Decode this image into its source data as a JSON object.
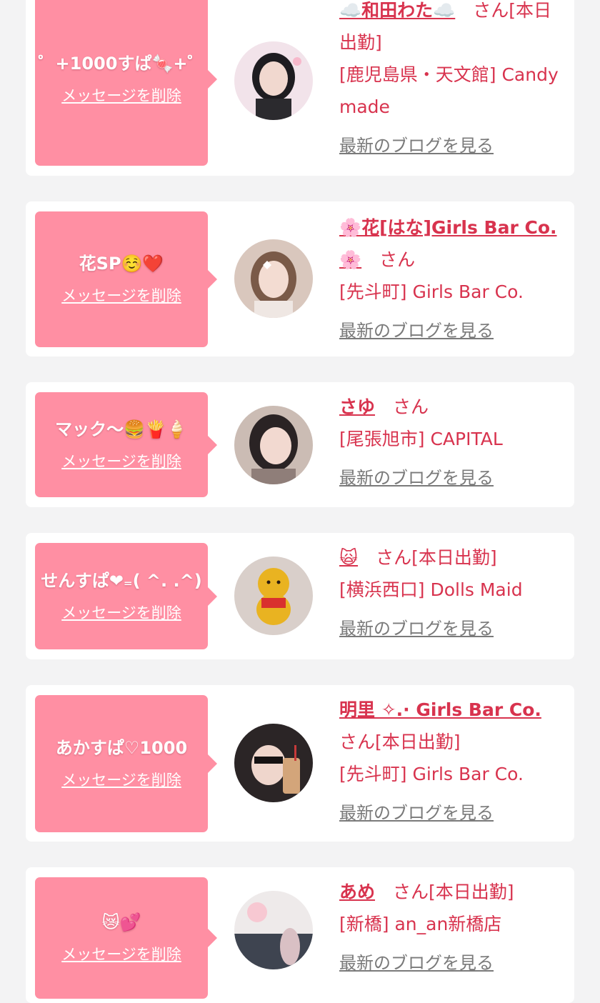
{
  "colors": {
    "accent": "#d8334e",
    "bubble": "#ff8fa3",
    "background": "#f3f3f4",
    "link_gray": "#7a7a7a"
  },
  "cards": [
    {
      "message": "゜+1000すぱ🍬+゜",
      "delete_label": "メッセージを削除",
      "name": "☁️和田わた☁️",
      "suffix": "　さん[本日出勤]",
      "shop": "[鹿児島県・天文館] Candy made",
      "blog_label": "最新のブログを見る"
    },
    {
      "message": "花SP☺️❤️",
      "delete_label": "メッセージを削除",
      "name": "🌸花[はな]Girls Bar Co.🌸",
      "suffix": "　さん",
      "shop": "[先斗町] Girls Bar Co.",
      "blog_label": "最新のブログを見る"
    },
    {
      "message": "マック〜🍔🍟🍦",
      "delete_label": "メッセージを削除",
      "name": "さゆ",
      "suffix": "　さん",
      "shop": "[尾張旭市] CAPITAL",
      "blog_label": "最新のブログを見る"
    },
    {
      "message": "せんすぱ❤︎₌( ^. .^)",
      "delete_label": "メッセージを削除",
      "name": "🙀",
      "suffix": "　さん[本日出勤]",
      "shop": "[横浜西口] Dolls Maid",
      "blog_label": "最新のブログを見る"
    },
    {
      "message": "あかすぱ♡1000",
      "delete_label": "メッセージを削除",
      "name": "明里 ✧.· Girls Bar Co.",
      "suffix": "さん[本日出勤]",
      "shop": "[先斗町] Girls Bar Co.",
      "blog_label": "最新のブログを見る"
    },
    {
      "message": "😿💕",
      "delete_label": "メッセージを削除",
      "name": "あめ",
      "suffix": "　さん[本日出勤]",
      "shop": "[新橋] an_an新橋店",
      "blog_label": "最新のブログを見る"
    }
  ]
}
